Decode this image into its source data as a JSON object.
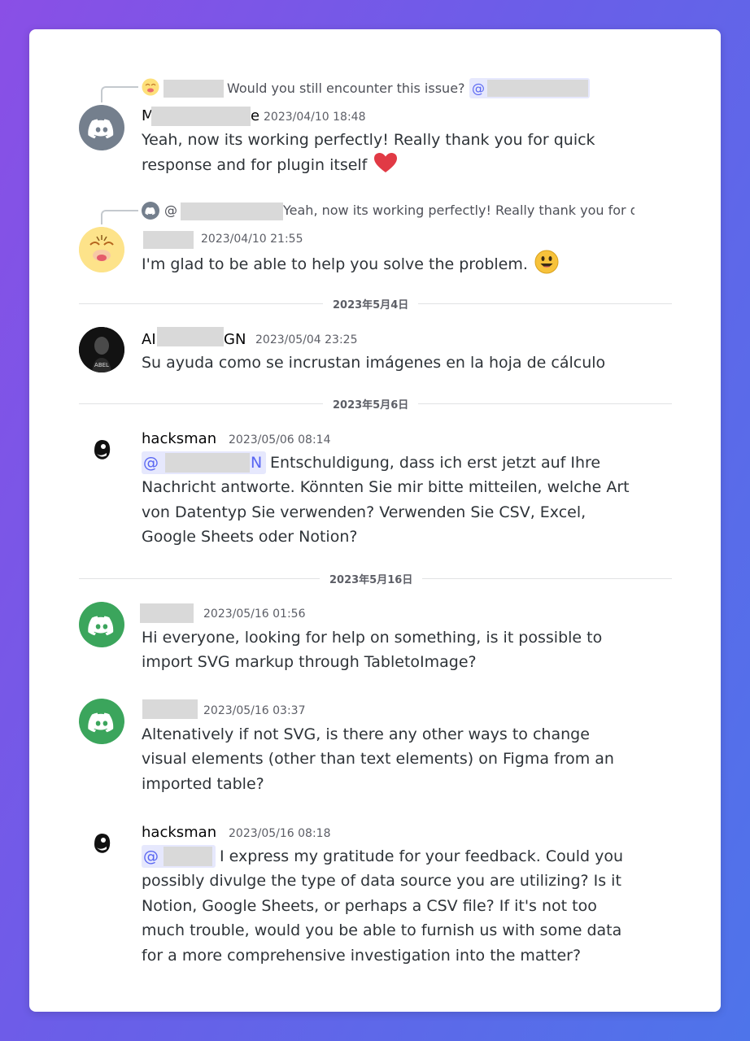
{
  "colors": {
    "accent": "#5865f2",
    "heart": "#e13a45",
    "discord_gray": "#747f8d",
    "discord_green": "#3ba55c"
  },
  "messages": {
    "m1": {
      "reply_text": "Would you still encounter this issue?",
      "reply_mention": "@",
      "author_head": "M",
      "author_tail": "e",
      "timestamp": "2023/04/10 18:48",
      "body": "Yeah, now its working perfectly! Really thank you for quick response and for plugin itself",
      "emoji": "heart"
    },
    "m2": {
      "reply_mention": "@",
      "reply_text": "Yeah, now its working perfectly! Really thank you for q",
      "timestamp": "2023/04/10 21:55",
      "body": "I'm glad to be able to help you solve the problem.",
      "emoji": "smiley"
    },
    "m3": {
      "author_head": "AI",
      "author_tail": "GN",
      "timestamp": "2023/05/04 23:25",
      "body": "Su ayuda como se incrustan imágenes en la hoja de cálculo"
    },
    "m4": {
      "author": "hacksman",
      "timestamp": "2023/05/06 08:14",
      "mention_head": "@",
      "mention_tail": "N",
      "body": "Entschuldigung, dass ich erst jetzt auf Ihre Nachricht antworte. Könnten Sie mir bitte mitteilen, welche Art von Datentyp Sie verwenden? Verwenden Sie CSV, Excel, Google Sheets oder Notion?"
    },
    "m5": {
      "timestamp": "2023/05/16 01:56",
      "body": "Hi everyone, looking for help on something, is it possible to import SVG markup through TabletoImage?"
    },
    "m6": {
      "timestamp": "2023/05/16 03:37",
      "body": "Altenatively if not SVG, is there any other ways to change visual elements (other than text elements) on Figma from an imported table?"
    },
    "m7": {
      "author": "hacksman",
      "timestamp": "2023/05/16 08:18",
      "mention_head": "@",
      "body": "I express my gratitude for your feedback. Could you possibly divulge the type of data source you are utilizing? Is it Notion, Google Sheets, or perhaps a CSV file? If it's not too much trouble, would you be able to furnish us with some data for a more comprehensive investigation into the matter?"
    }
  },
  "dividers": {
    "d1": "2023年5月4日",
    "d2": "2023年5月6日",
    "d3": "2023年5月16日"
  }
}
